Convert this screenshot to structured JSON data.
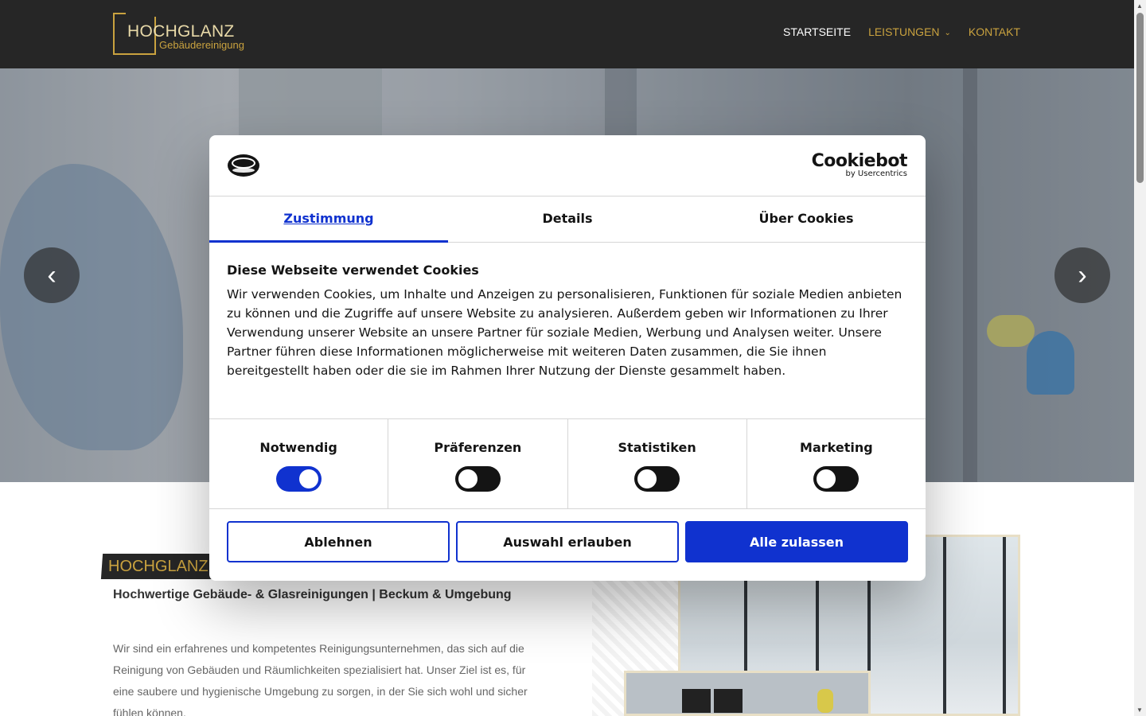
{
  "header": {
    "logo_main": "HOCHGLANZ",
    "logo_sub": "Gebäudereinigung",
    "nav": [
      {
        "label": "STARTSEITE",
        "active": true
      },
      {
        "label": "LEISTUNGEN",
        "has_dropdown": true
      },
      {
        "label": "KONTAKT"
      }
    ]
  },
  "hero": {
    "prev_icon": "chevron-left-icon",
    "next_icon": "chevron-right-icon",
    "prev_glyph": "‹",
    "next_glyph": "›"
  },
  "content": {
    "label": "HOCHGLANZ",
    "subtitle": "Hochwertige Gebäude- & Glasreinigungen | Beckum & Umgebung",
    "paragraph": "Wir sind ein erfahrenes und kompetentes Reinigungsunternehmen, das sich auf die Reinigung von Gebäuden und Räumlichkeiten spezialisiert hat. Unser Ziel ist es, für eine saubere und hygienische Umgebung zu sorgen, in der Sie sich wohl und sicher fühlen können."
  },
  "cookie_modal": {
    "brand_name": "Cookiebot",
    "brand_by": "by Usercentrics",
    "tabs": [
      "Zustimmung",
      "Details",
      "Über Cookies"
    ],
    "active_tab": "Zustimmung",
    "title": "Diese Webseite verwendet Cookies",
    "body": "Wir verwenden Cookies, um Inhalte und Anzeigen zu personalisieren, Funktionen für soziale Medien anbieten zu können und die Zugriffe auf unsere Website zu analysieren. Außerdem geben wir Informationen zu Ihrer Verwendung unserer Website an unsere Partner für soziale Medien, Werbung und Analysen weiter. Unsere Partner führen diese Informationen möglicherweise mit weiteren Daten zusammen, die Sie ihnen bereitgestellt haben oder die sie im Rahmen Ihrer Nutzung der Dienste gesammelt haben.",
    "categories": [
      {
        "label": "Notwendig",
        "enabled": true
      },
      {
        "label": "Präferenzen",
        "enabled": false
      },
      {
        "label": "Statistiken",
        "enabled": false
      },
      {
        "label": "Marketing",
        "enabled": false
      }
    ],
    "buttons": {
      "decline": "Ablehnen",
      "allow_selection": "Auswahl erlauben",
      "allow_all": "Alle zulassen"
    }
  },
  "colors": {
    "accent_gold": "#c9a23f",
    "header_bg": "#262626",
    "cookie_blue": "#1032cf"
  }
}
